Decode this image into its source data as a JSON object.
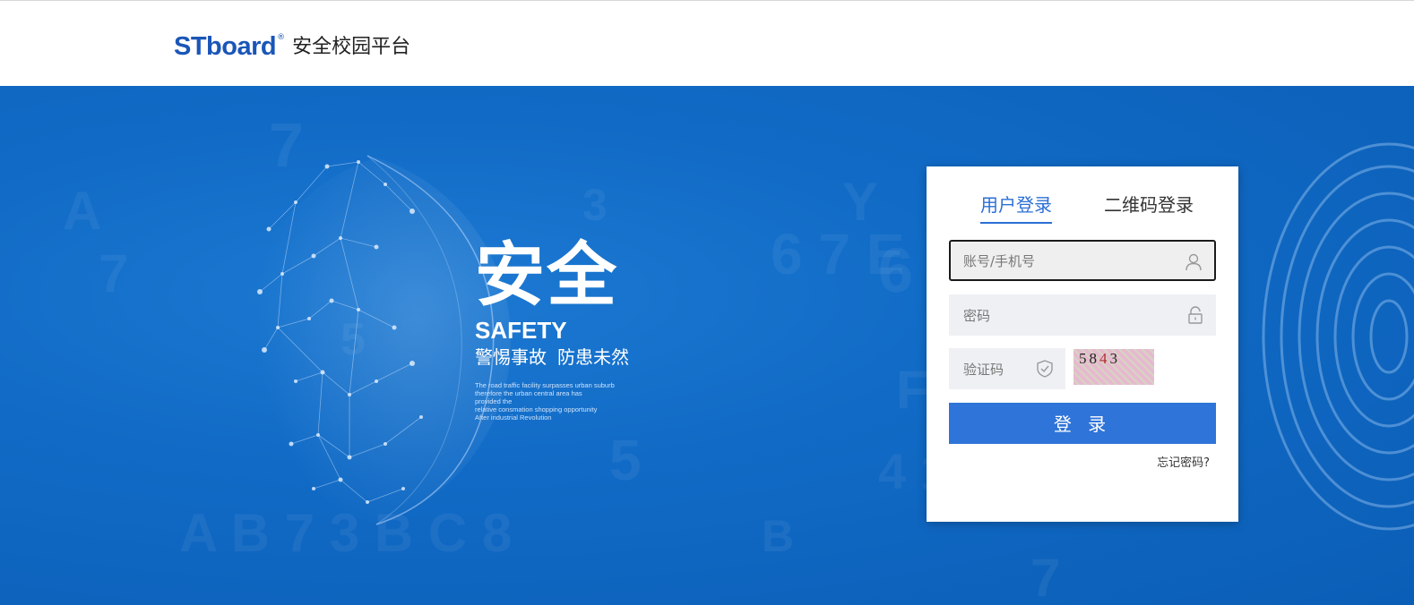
{
  "header": {
    "brand": "STboard",
    "registered": "®",
    "title": "安全校园平台"
  },
  "hero": {
    "slogan_main": "安全",
    "slogan_en": "SAFETY",
    "slogan_zh_1": "警惕事故",
    "slogan_zh_2": "防患未然",
    "slogan_small_lines": [
      "The road traffic facility surpasses urban suburb",
      "therefore the urban central area has",
      "provided the",
      "relative consmation shopping opportunity",
      "After industrial Revolution"
    ]
  },
  "login": {
    "tabs": {
      "user": "用户登录",
      "qr": "二维码登录"
    },
    "account": {
      "placeholder": "账号/手机号",
      "value": ""
    },
    "password": {
      "placeholder": "密码",
      "value": ""
    },
    "captcha": {
      "placeholder": "验证码",
      "value": "",
      "image_text": [
        "5",
        "8",
        "4",
        "3"
      ]
    },
    "submit_label": "登 录",
    "forgot_label": "忘记密码?"
  },
  "colors": {
    "brand_blue": "#1a56b8",
    "accent": "#2f74d8",
    "hero_bg": "#116bc6"
  },
  "icons": {
    "account": "user-icon",
    "password": "lock-icon",
    "captcha": "shield-check-icon"
  }
}
